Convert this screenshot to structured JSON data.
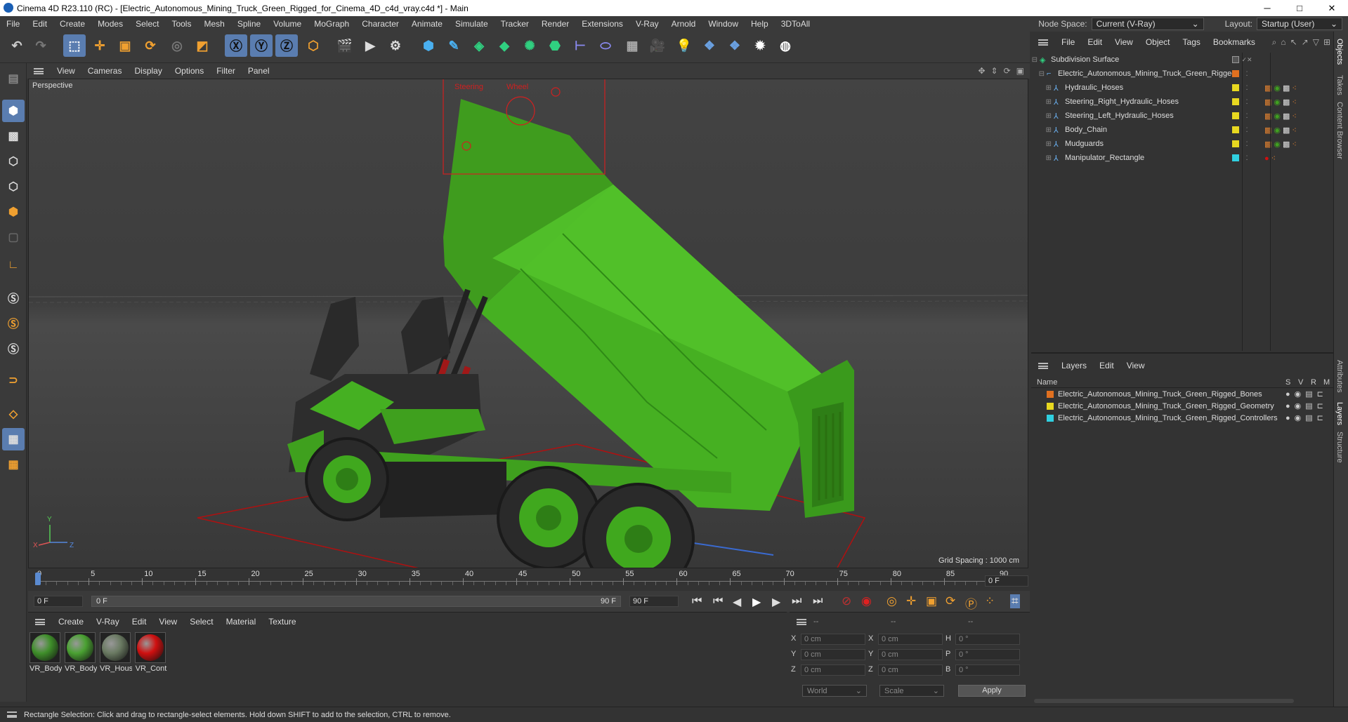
{
  "window": {
    "title": "Cinema 4D R23.110 (RC) - [Electric_Autonomous_Mining_Truck_Green_Rigged_for_Cinema_4D_c4d_vray.c4d *] - Main",
    "min": "─",
    "max": "□",
    "close": "✕"
  },
  "menu": [
    "File",
    "Edit",
    "Create",
    "Modes",
    "Select",
    "Tools",
    "Mesh",
    "Spline",
    "Volume",
    "MoGraph",
    "Character",
    "Animate",
    "Simulate",
    "Tracker",
    "Render",
    "Extensions",
    "V-Ray",
    "Arnold",
    "Window",
    "Help",
    "3DToAll"
  ],
  "node_space": {
    "label": "Node Space:",
    "value": "Current (V-Ray)"
  },
  "layout": {
    "label": "Layout:",
    "value": "Startup (User)"
  },
  "viewport_menu": [
    "View",
    "Cameras",
    "Display",
    "Options",
    "Filter",
    "Panel"
  ],
  "viewport": {
    "label": "Perspective",
    "grid_spacing": "Grid Spacing : 1000 cm",
    "axis_y": "Y",
    "axis_x": "X",
    "axis_z": "Z",
    "rig_labels": [
      "Steering",
      "Wheel"
    ]
  },
  "timeline": {
    "ticks": [
      "0",
      "5",
      "10",
      "15",
      "20",
      "25",
      "30",
      "35",
      "40",
      "45",
      "50",
      "55",
      "60",
      "65",
      "70",
      "75",
      "80",
      "85",
      "90"
    ],
    "current_frame": "0 F"
  },
  "playbar": {
    "start": "0 F",
    "range_start": "0 F",
    "range_end": "90 F",
    "end": "90 F"
  },
  "material_menu": [
    "Create",
    "V-Ray",
    "Edit",
    "View",
    "Select",
    "Material",
    "Texture"
  ],
  "materials": [
    {
      "label": "VR_Body",
      "color": "#3f8f2a"
    },
    {
      "label": "VR_Body",
      "color": "#4aa132"
    },
    {
      "label": "VR_Hous",
      "color": "#6a7a62"
    },
    {
      "label": "VR_Cont",
      "color": "#d01010"
    }
  ],
  "coords": {
    "headers": [
      "--",
      "--",
      "--"
    ],
    "rows": [
      {
        "a": "X",
        "av": "0 cm",
        "b": "X",
        "bv": "0 cm",
        "c": "H",
        "cv": "0 °"
      },
      {
        "a": "Y",
        "av": "0 cm",
        "b": "Y",
        "bv": "0 cm",
        "c": "P",
        "cv": "0 °"
      },
      {
        "a": "Z",
        "av": "0 cm",
        "b": "Z",
        "bv": "0 cm",
        "c": "B",
        "cv": "0 °"
      }
    ],
    "world": "World",
    "scale": "Scale",
    "apply": "Apply"
  },
  "objects_menu": [
    "File",
    "Edit",
    "View",
    "Object",
    "Tags",
    "Bookmarks"
  ],
  "objects": [
    {
      "name": "Subdivision Surface",
      "indent": 0,
      "color": "",
      "root": true
    },
    {
      "name": "Electric_Autonomous_Mining_Truck_Green_Rigged",
      "indent": 1,
      "color": "#e07020"
    },
    {
      "name": "Hydraulic_Hoses",
      "indent": 2,
      "color": "#e8d820"
    },
    {
      "name": "Steering_Right_Hydraulic_Hoses",
      "indent": 2,
      "color": "#e8d820"
    },
    {
      "name": "Steering_Left_Hydraulic_Hoses",
      "indent": 2,
      "color": "#e8d820"
    },
    {
      "name": "Body_Chain",
      "indent": 2,
      "color": "#e8d820"
    },
    {
      "name": "Mudguards",
      "indent": 2,
      "color": "#e8d820"
    },
    {
      "name": "Manipulator_Rectangle",
      "indent": 2,
      "color": "#30d0e0"
    }
  ],
  "layers_menu": [
    "Layers",
    "Edit",
    "View"
  ],
  "layers_header": {
    "name": "Name",
    "cols": [
      "S",
      "V",
      "R",
      "M"
    ]
  },
  "layers": [
    {
      "name": "Electric_Autonomous_Mining_Truck_Green_Rigged_Bones",
      "color": "#e07020"
    },
    {
      "name": "Electric_Autonomous_Mining_Truck_Green_Rigged_Geometry",
      "color": "#e8d820"
    },
    {
      "name": "Electric_Autonomous_Mining_Truck_Green_Rigged_Controllers",
      "color": "#30d0e0"
    }
  ],
  "side_tabs": [
    "Objects",
    "Takes",
    "Content Browser",
    "Attributes",
    "Layers",
    "Structure"
  ],
  "status": "Rectangle Selection: Click and drag to rectangle-select elements. Hold down SHIFT to add to the selection, CTRL to remove."
}
